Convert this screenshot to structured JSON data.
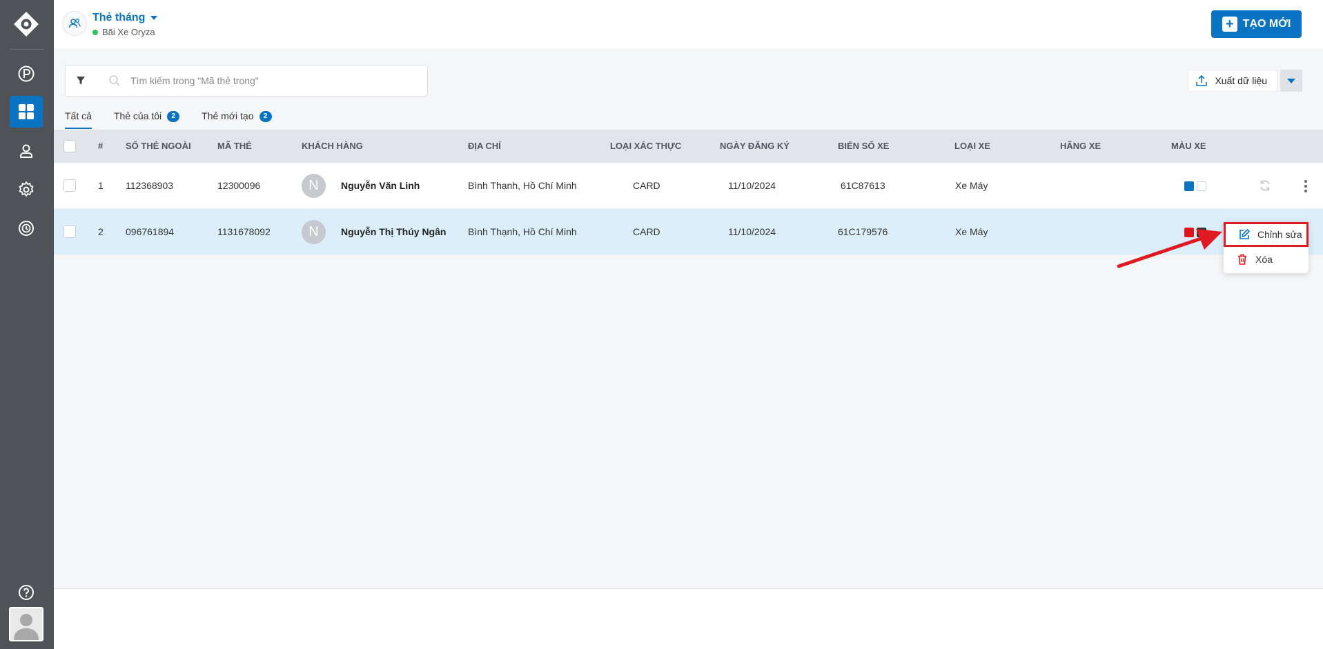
{
  "header": {
    "title": "Thẻ tháng",
    "subtitle": "Bãi Xe Oryza",
    "create_label": "TẠO MỚI"
  },
  "toolbar": {
    "search_placeholder": "Tìm kiếm trong \"Mã thẻ trong\"",
    "export_label": "Xuất dữ liệu"
  },
  "tabs": [
    {
      "label": "Tất cả",
      "badge": ""
    },
    {
      "label": "Thẻ của tôi",
      "badge": "2"
    },
    {
      "label": "Thẻ mới tạo",
      "badge": "2"
    }
  ],
  "table": {
    "columns": [
      "#",
      "SỐ THẺ NGOÀI",
      "MÃ THẺ",
      "KHÁCH HÀNG",
      "ĐỊA CHỈ",
      "LOẠI XÁC THỰC",
      "NGÀY ĐĂNG KÝ",
      "BIỂN SỐ XE",
      "LOẠI XE",
      "HÃNG XE",
      "MÀU XE"
    ],
    "rows": [
      {
        "index": "1",
        "external_no": "112368903",
        "card_code": "12300096",
        "avatar_letter": "N",
        "customer": "Nguyễn Văn Linh",
        "address": "Bình Thạnh, Hồ Chí Minh",
        "auth_type": "CARD",
        "reg_date": "11/10/2024",
        "plate": "61C87613",
        "vehicle_type": "Xe Máy",
        "brand": "",
        "colors": [
          "#0a74c2",
          "#ffffff"
        ]
      },
      {
        "index": "2",
        "external_no": "096761894",
        "card_code": "1131678092",
        "avatar_letter": "N",
        "customer": "Nguyễn Thị Thúy Ngân",
        "address": "Bình Thạnh, Hồ Chí Minh",
        "auth_type": "CARD",
        "reg_date": "11/10/2024",
        "plate": "61C179576",
        "vehicle_type": "Xe Máy",
        "brand": "",
        "colors": [
          "#e0141c",
          "#333333"
        ]
      }
    ]
  },
  "context_menu": {
    "edit_label": "Chỉnh sửa",
    "delete_label": "Xóa"
  },
  "colors": {
    "accent": "#0a74c2",
    "sidebar": "#4f5257",
    "highlight": "#e01a22"
  }
}
